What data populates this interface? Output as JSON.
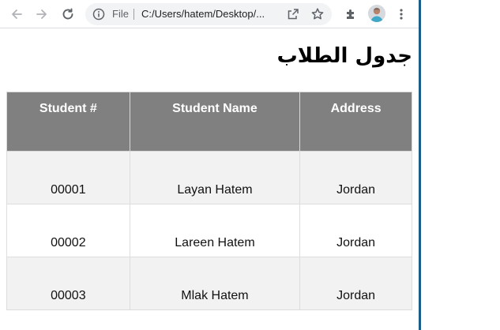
{
  "browser": {
    "address": {
      "scheme_label": "File",
      "url": "C:/Users/hatem/Desktop/..."
    },
    "icons": [
      "back-arrow-icon",
      "forward-arrow-icon",
      "reload-icon",
      "info-icon",
      "share-icon",
      "star-icon",
      "extensions-icon",
      "avatar",
      "menu-icon"
    ]
  },
  "page": {
    "title": "جدول الطلاب",
    "table": {
      "headers": [
        "Student #",
        "Student Name",
        "Address"
      ],
      "rows": [
        [
          "00001",
          "Layan Hatem",
          "Jordan"
        ],
        [
          "00002",
          "Lareen Hatem",
          "Jordan"
        ],
        [
          "00003",
          "Mlak Hatem",
          "Jordan"
        ]
      ]
    }
  },
  "colors": {
    "header_bg": "#808080",
    "header_text": "#ffffff",
    "row_alt_bg": "#f2f2f2",
    "window_edge": "#1a5d8a"
  }
}
